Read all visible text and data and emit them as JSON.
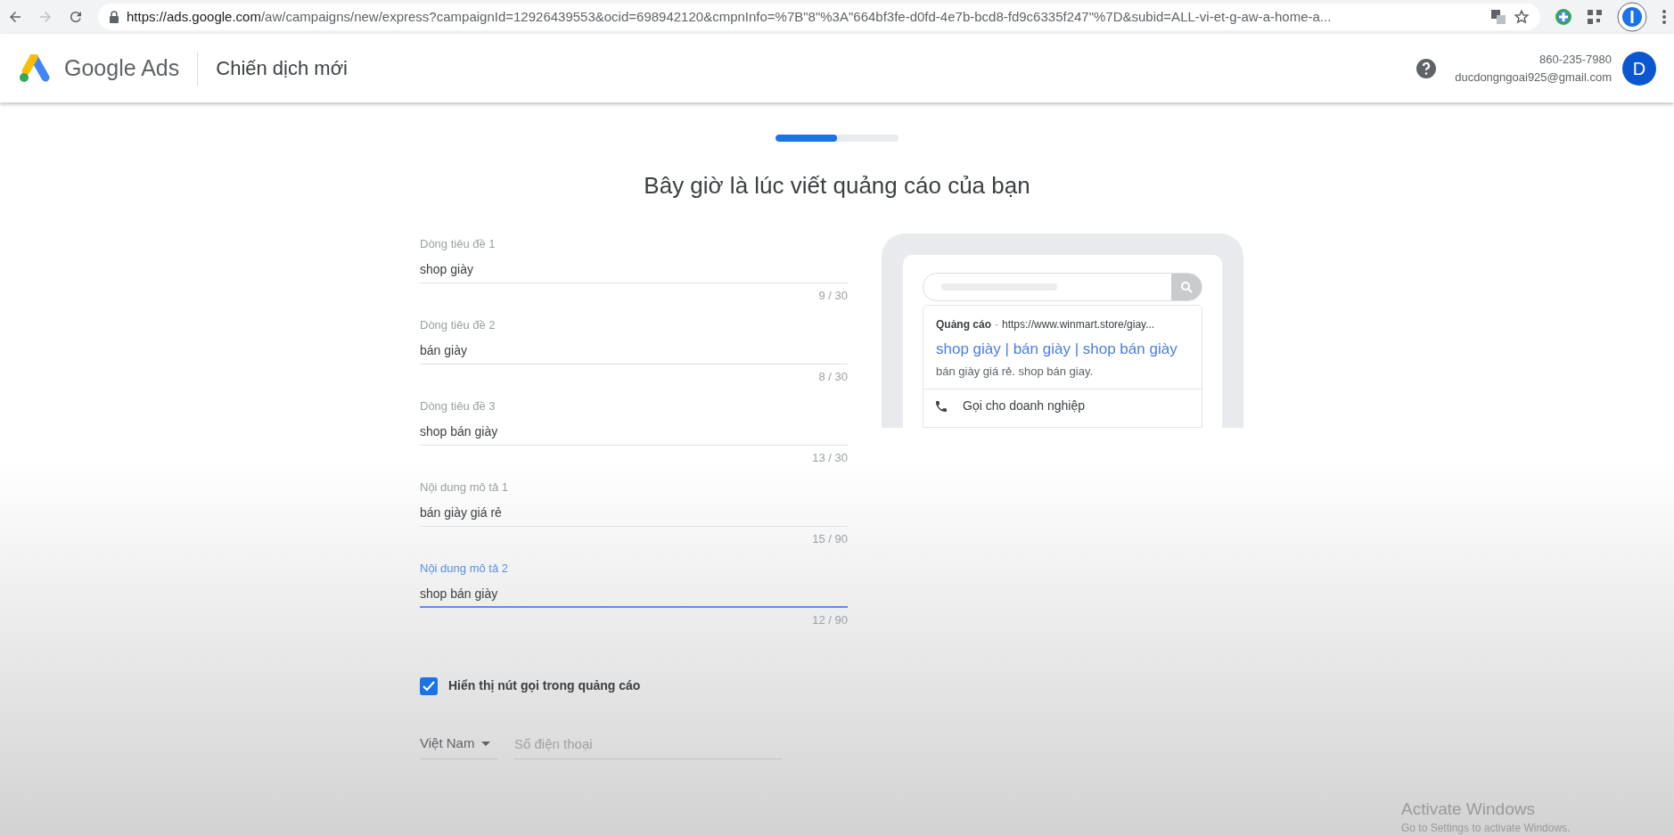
{
  "browser": {
    "url_host": "https://ads.google.com",
    "url_path": "/aw/campaigns/new/express?campaignId=12926439553&ocid=698942120&cmpnInfo=%7B\"8\"%3A\"664bf3fe-d0fd-4e7b-bcd8-fd9c6335f247\"%7D&subid=ALL-vi-et-g-aw-a-home-a..."
  },
  "header": {
    "product": "Google Ads",
    "page_title": "Chiến dịch mới",
    "phone": "860-235-7980",
    "email": "ducdongngoai925@gmail.com",
    "avatar_letter": "D"
  },
  "progress": {
    "level": 0.5
  },
  "heading": "Bây giờ là lúc viết quảng cáo của bạn",
  "fields": [
    {
      "label": "Dòng tiêu đề 1",
      "value": "shop giày",
      "counter": "9 / 30",
      "focused": false
    },
    {
      "label": "Dòng tiêu đề 2",
      "value": "bán giày",
      "counter": "8 / 30",
      "focused": false
    },
    {
      "label": "Dòng tiêu đề 3",
      "value": "shop bán giày",
      "counter": "13 / 30",
      "focused": false
    },
    {
      "label": "Nội dung mô tả 1",
      "value": "bán giày giá rẻ",
      "counter": "15 / 90",
      "focused": false
    },
    {
      "label": "Nội dung mô tả 2",
      "value": "shop bán giày",
      "counter": "12 / 90",
      "focused": true
    }
  ],
  "call_button": {
    "label": "Hiển thị nút gọi trong quảng cáo",
    "checked": true
  },
  "phone_row": {
    "country": "Việt Nam",
    "placeholder": "Số điện thoại"
  },
  "preview": {
    "ad_label": "Quảng cáo",
    "separator": "·",
    "url": "https://www.winmart.store/giay...",
    "headline": "shop giày | bán giày | shop bán giày",
    "description": "bán giày giá rẻ. shop bán giay.",
    "call_text": "Gọi cho doanh nghiệp"
  },
  "os_notice": {
    "title": "Activate Windows",
    "subtitle": "Go to Settings to activate Windows."
  }
}
